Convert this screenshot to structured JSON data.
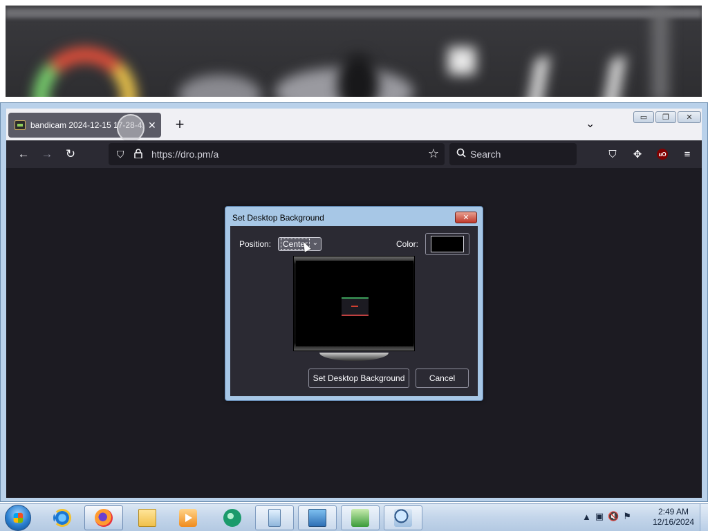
{
  "browser": {
    "tab": {
      "title": "bandicam 2024-12-15 17-28-41",
      "close_glyph": "✕"
    },
    "new_tab_glyph": "+",
    "tab_list_glyph": "⌄",
    "window_controls": {
      "minimize": "▭",
      "restore": "❐",
      "close": "✕"
    },
    "nav": {
      "back": "←",
      "forward": "→",
      "reload": "↻"
    },
    "url": "https://dro.pm/a",
    "url_icons": {
      "shield": "⛉",
      "lock": "🔒",
      "bookmark": "☆"
    },
    "search": {
      "placeholder": "Search",
      "icon": "⚲"
    },
    "toolbar_icons": {
      "pocket": "⛉",
      "extensions": "✥",
      "ublock": "uO",
      "menu": "≡"
    }
  },
  "dialog": {
    "title": "Set Desktop Background",
    "close_glyph": "✕",
    "position_label": "Position:",
    "position_value": "Center",
    "position_caret": "⌄",
    "color_label": "Color:",
    "color_value": "#000000",
    "set_button": "Set Desktop Background",
    "cancel_button": "Cancel"
  },
  "taskbar": {
    "apps": [
      {
        "name": "internet-explorer"
      },
      {
        "name": "firefox",
        "active": true
      },
      {
        "name": "windows-explorer"
      },
      {
        "name": "media-center"
      },
      {
        "name": "windows-media-player"
      },
      {
        "name": "document"
      },
      {
        "name": "control-panel"
      },
      {
        "name": "network-tool"
      },
      {
        "name": "search-tool"
      }
    ],
    "tray": {
      "chevron": "▲",
      "network": "▣",
      "volume": "🔇",
      "flag": "⚑"
    },
    "time": "2:49 AM",
    "date": "12/16/2024"
  }
}
